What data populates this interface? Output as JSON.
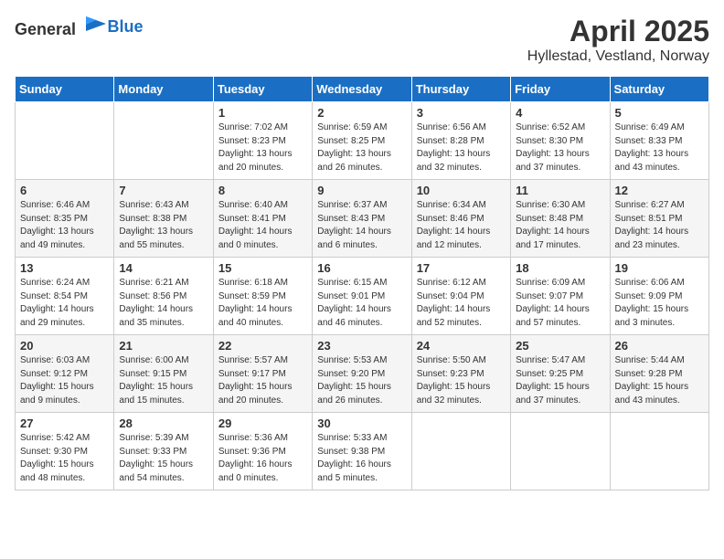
{
  "header": {
    "logo_general": "General",
    "logo_blue": "Blue",
    "month": "April 2025",
    "location": "Hyllestad, Vestland, Norway"
  },
  "weekdays": [
    "Sunday",
    "Monday",
    "Tuesday",
    "Wednesday",
    "Thursday",
    "Friday",
    "Saturday"
  ],
  "weeks": [
    [
      {
        "day": "",
        "info": ""
      },
      {
        "day": "",
        "info": ""
      },
      {
        "day": "1",
        "info": "Sunrise: 7:02 AM\nSunset: 8:23 PM\nDaylight: 13 hours\nand 20 minutes."
      },
      {
        "day": "2",
        "info": "Sunrise: 6:59 AM\nSunset: 8:25 PM\nDaylight: 13 hours\nand 26 minutes."
      },
      {
        "day": "3",
        "info": "Sunrise: 6:56 AM\nSunset: 8:28 PM\nDaylight: 13 hours\nand 32 minutes."
      },
      {
        "day": "4",
        "info": "Sunrise: 6:52 AM\nSunset: 8:30 PM\nDaylight: 13 hours\nand 37 minutes."
      },
      {
        "day": "5",
        "info": "Sunrise: 6:49 AM\nSunset: 8:33 PM\nDaylight: 13 hours\nand 43 minutes."
      }
    ],
    [
      {
        "day": "6",
        "info": "Sunrise: 6:46 AM\nSunset: 8:35 PM\nDaylight: 13 hours\nand 49 minutes."
      },
      {
        "day": "7",
        "info": "Sunrise: 6:43 AM\nSunset: 8:38 PM\nDaylight: 13 hours\nand 55 minutes."
      },
      {
        "day": "8",
        "info": "Sunrise: 6:40 AM\nSunset: 8:41 PM\nDaylight: 14 hours\nand 0 minutes."
      },
      {
        "day": "9",
        "info": "Sunrise: 6:37 AM\nSunset: 8:43 PM\nDaylight: 14 hours\nand 6 minutes."
      },
      {
        "day": "10",
        "info": "Sunrise: 6:34 AM\nSunset: 8:46 PM\nDaylight: 14 hours\nand 12 minutes."
      },
      {
        "day": "11",
        "info": "Sunrise: 6:30 AM\nSunset: 8:48 PM\nDaylight: 14 hours\nand 17 minutes."
      },
      {
        "day": "12",
        "info": "Sunrise: 6:27 AM\nSunset: 8:51 PM\nDaylight: 14 hours\nand 23 minutes."
      }
    ],
    [
      {
        "day": "13",
        "info": "Sunrise: 6:24 AM\nSunset: 8:54 PM\nDaylight: 14 hours\nand 29 minutes."
      },
      {
        "day": "14",
        "info": "Sunrise: 6:21 AM\nSunset: 8:56 PM\nDaylight: 14 hours\nand 35 minutes."
      },
      {
        "day": "15",
        "info": "Sunrise: 6:18 AM\nSunset: 8:59 PM\nDaylight: 14 hours\nand 40 minutes."
      },
      {
        "day": "16",
        "info": "Sunrise: 6:15 AM\nSunset: 9:01 PM\nDaylight: 14 hours\nand 46 minutes."
      },
      {
        "day": "17",
        "info": "Sunrise: 6:12 AM\nSunset: 9:04 PM\nDaylight: 14 hours\nand 52 minutes."
      },
      {
        "day": "18",
        "info": "Sunrise: 6:09 AM\nSunset: 9:07 PM\nDaylight: 14 hours\nand 57 minutes."
      },
      {
        "day": "19",
        "info": "Sunrise: 6:06 AM\nSunset: 9:09 PM\nDaylight: 15 hours\nand 3 minutes."
      }
    ],
    [
      {
        "day": "20",
        "info": "Sunrise: 6:03 AM\nSunset: 9:12 PM\nDaylight: 15 hours\nand 9 minutes."
      },
      {
        "day": "21",
        "info": "Sunrise: 6:00 AM\nSunset: 9:15 PM\nDaylight: 15 hours\nand 15 minutes."
      },
      {
        "day": "22",
        "info": "Sunrise: 5:57 AM\nSunset: 9:17 PM\nDaylight: 15 hours\nand 20 minutes."
      },
      {
        "day": "23",
        "info": "Sunrise: 5:53 AM\nSunset: 9:20 PM\nDaylight: 15 hours\nand 26 minutes."
      },
      {
        "day": "24",
        "info": "Sunrise: 5:50 AM\nSunset: 9:23 PM\nDaylight: 15 hours\nand 32 minutes."
      },
      {
        "day": "25",
        "info": "Sunrise: 5:47 AM\nSunset: 9:25 PM\nDaylight: 15 hours\nand 37 minutes."
      },
      {
        "day": "26",
        "info": "Sunrise: 5:44 AM\nSunset: 9:28 PM\nDaylight: 15 hours\nand 43 minutes."
      }
    ],
    [
      {
        "day": "27",
        "info": "Sunrise: 5:42 AM\nSunset: 9:30 PM\nDaylight: 15 hours\nand 48 minutes."
      },
      {
        "day": "28",
        "info": "Sunrise: 5:39 AM\nSunset: 9:33 PM\nDaylight: 15 hours\nand 54 minutes."
      },
      {
        "day": "29",
        "info": "Sunrise: 5:36 AM\nSunset: 9:36 PM\nDaylight: 16 hours\nand 0 minutes."
      },
      {
        "day": "30",
        "info": "Sunrise: 5:33 AM\nSunset: 9:38 PM\nDaylight: 16 hours\nand 5 minutes."
      },
      {
        "day": "",
        "info": ""
      },
      {
        "day": "",
        "info": ""
      },
      {
        "day": "",
        "info": ""
      }
    ]
  ]
}
